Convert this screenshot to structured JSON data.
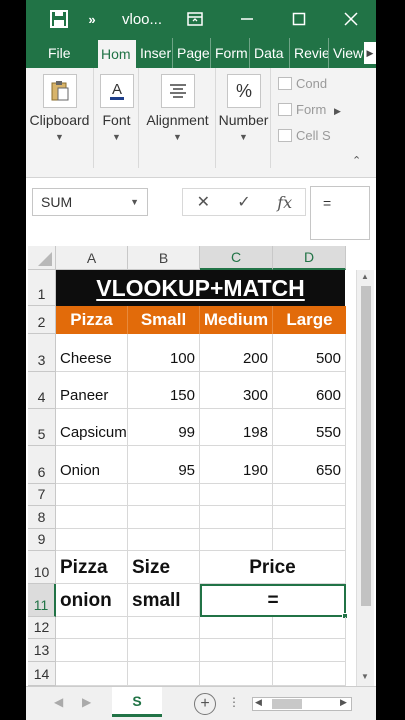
{
  "titlebar": {
    "title": "vloo...",
    "more_glyph": "»",
    "icons": [
      "save-icon",
      "more-icon",
      "ribbon-display-icon",
      "minimize-icon",
      "maximize-icon",
      "close-icon"
    ]
  },
  "tabs": [
    "File",
    "Hom",
    "Inser",
    "Page",
    "Form",
    "Data",
    "Revie",
    "View"
  ],
  "ribbon": {
    "clipboard": "Clipboard",
    "font": "Font",
    "alignment": "Alignment",
    "number": "Number",
    "number_icon": "%",
    "styles": [
      "Cond",
      "Form",
      "Cell S"
    ]
  },
  "formula_bar": {
    "name_box": "SUM",
    "cancel": "✕",
    "enter": "✓",
    "fx": "fx",
    "value": "="
  },
  "columns": [
    "A",
    "B",
    "C",
    "D"
  ],
  "rows": [
    "1",
    "2",
    "3",
    "4",
    "5",
    "6",
    "7",
    "8",
    "9",
    "10",
    "11",
    "12",
    "13",
    "14"
  ],
  "sheet": {
    "title": "VLOOKUP+MATCH",
    "headers": [
      "Pizza",
      "Small",
      "Medium",
      "Large"
    ],
    "data": [
      [
        "Cheese",
        "100",
        "200",
        "500"
      ],
      [
        "Paneer",
        "150",
        "300",
        "600"
      ],
      [
        "Capsicum",
        "99",
        "198",
        "550"
      ],
      [
        "Onion",
        "95",
        "190",
        "650"
      ]
    ],
    "lookup_headers": [
      "Pizza",
      "Size",
      "Price"
    ],
    "lookup_values": [
      "onion",
      "small",
      "="
    ]
  },
  "sheetbar": {
    "tab": "S",
    "add": "+",
    "dots": "⋮"
  },
  "colors": {
    "excel_green": "#217346",
    "header_orange": "#e26b0a",
    "title_black": "#0d0d0d"
  }
}
